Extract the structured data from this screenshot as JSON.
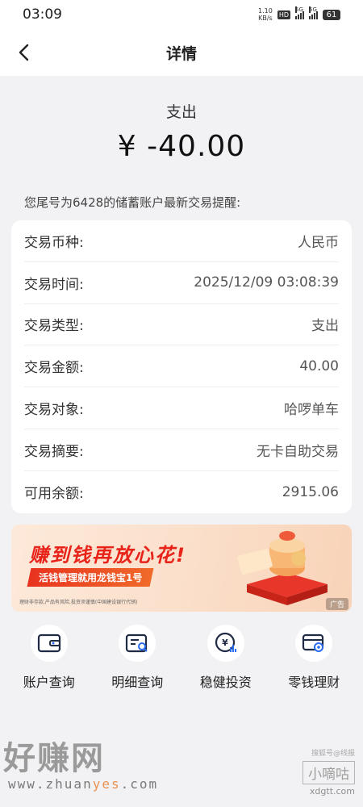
{
  "status_bar": {
    "time": "03:09",
    "net_speed_value": "1.10",
    "net_speed_unit": "KB/s",
    "hd": "HD",
    "sim1": "5G",
    "sim2": "5G",
    "battery": "61"
  },
  "nav": {
    "title": "详情",
    "back_icon": "chevron-left-icon"
  },
  "summary": {
    "type": "支出",
    "amount": "¥ -40.00"
  },
  "notice": "您尾号为6428的储蓄账户最新交易提醒:",
  "details": [
    {
      "label": "交易币种:",
      "value": "人民币"
    },
    {
      "label": "交易时间:",
      "value": "2025/12/09 03:08:39"
    },
    {
      "label": "交易类型:",
      "value": "支出"
    },
    {
      "label": "交易金额:",
      "value": "40.00"
    },
    {
      "label": "交易对象:",
      "value": "哈啰单车"
    },
    {
      "label": "交易摘要:",
      "value": "无卡自助交易"
    },
    {
      "label": "可用余额:",
      "value": "2915.06"
    }
  ],
  "banner": {
    "headline": "赚到钱再放心花!",
    "sub": "活钱管理就用龙钱宝1号",
    "disclaimer": "理财非存款,产品有风险,投资须谨慎(中国建设银行代销)",
    "ad_tag": "广告",
    "colors": {
      "headline": "#e8241a",
      "accent": "#e8331f"
    }
  },
  "quick_links": [
    {
      "label": "账户查询",
      "icon": "wallet-icon"
    },
    {
      "label": "明细查询",
      "icon": "list-search-icon"
    },
    {
      "label": "稳健投资",
      "icon": "yuan-chart-icon"
    },
    {
      "label": "零钱理财",
      "icon": "card-coin-icon"
    }
  ],
  "watermarks": {
    "left_big": "好赚网",
    "left_url_prefix": "www.zhuan",
    "left_url_highlight": "yes",
    "left_url_suffix": ".com",
    "right_small": "搜狐号@线报",
    "right_box": "小嘀咕",
    "right_url": "xdgtt.com"
  }
}
